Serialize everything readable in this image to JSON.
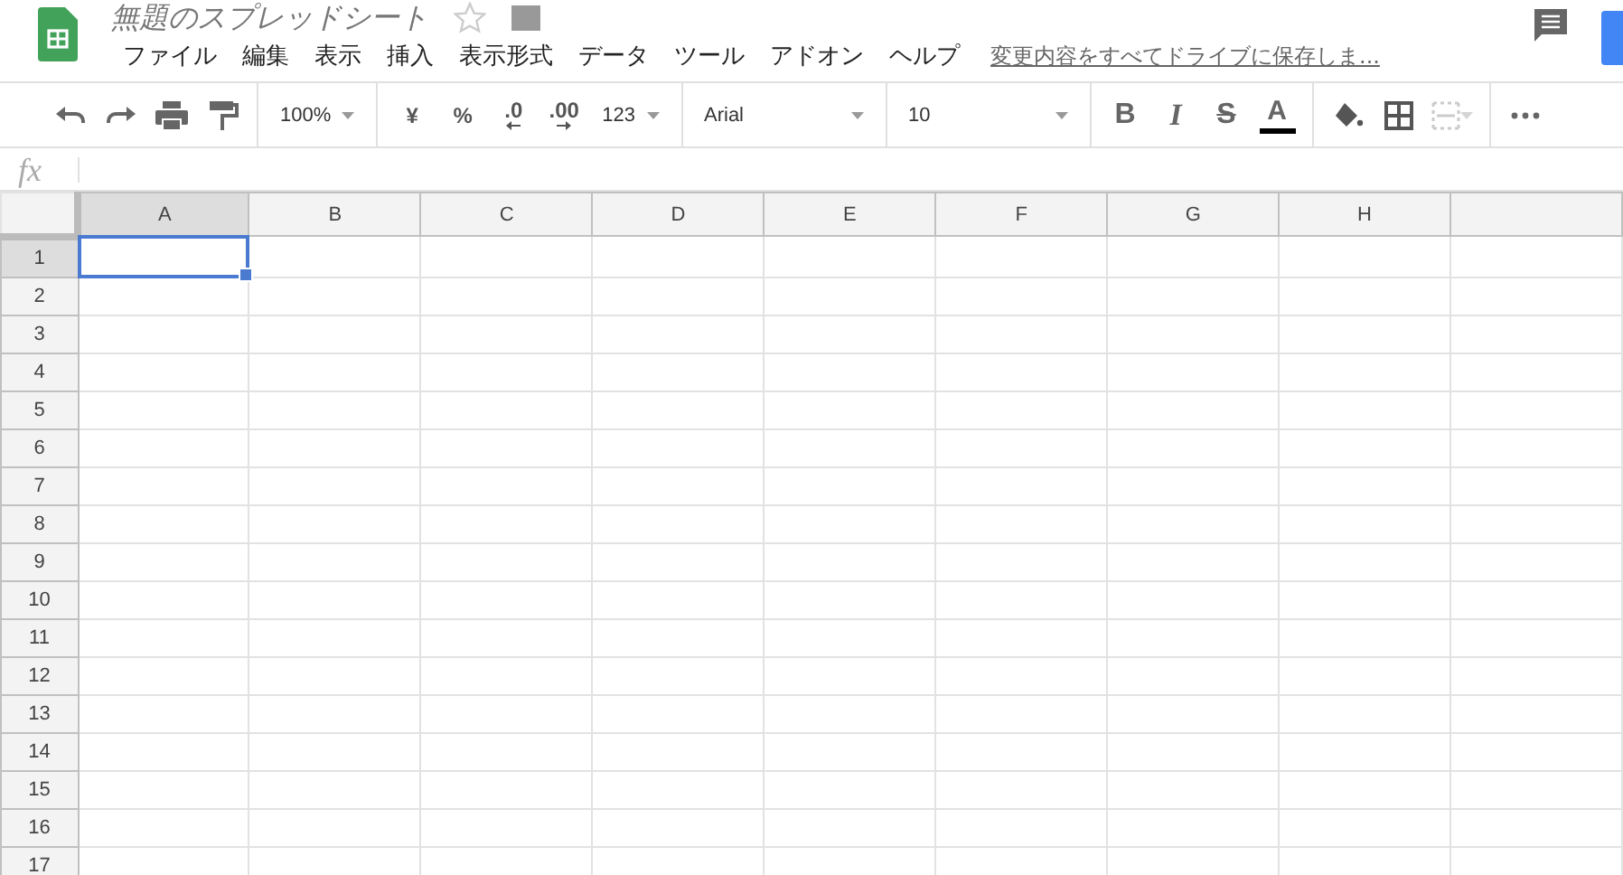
{
  "title": "無題のスプレッドシート",
  "menu": [
    "ファイル",
    "編集",
    "表示",
    "挿入",
    "表示形式",
    "データ",
    "ツール",
    "アドオン",
    "ヘルプ"
  ],
  "save_status": "変更内容をすべてドライブに保存しま...",
  "toolbar": [
    [
      {
        "kind": "undo"
      },
      {
        "kind": "redo"
      },
      {
        "kind": "print"
      },
      {
        "kind": "paint-format"
      }
    ],
    [
      {
        "kind": "dropdown",
        "text": "100%"
      }
    ],
    [
      {
        "kind": "glyph",
        "text": "¥"
      },
      {
        "kind": "glyph",
        "text": "%"
      },
      {
        "kind": "decimal-less",
        "text": ".0"
      },
      {
        "kind": "decimal-more",
        "text": ".00"
      },
      {
        "kind": "dropdown",
        "text": "123"
      }
    ],
    [
      {
        "kind": "select",
        "text": "Arial"
      }
    ],
    [
      {
        "kind": "select",
        "text": "10"
      }
    ],
    [
      {
        "kind": "bold",
        "text": "B"
      },
      {
        "kind": "italic",
        "text": "I"
      },
      {
        "kind": "strike",
        "text": "S"
      },
      {
        "kind": "text-color",
        "text": "A"
      }
    ],
    [
      {
        "kind": "fill"
      },
      {
        "kind": "borders"
      },
      {
        "kind": "merge",
        "disabled": true
      }
    ],
    [
      {
        "kind": "more"
      }
    ]
  ],
  "formula_label": "fx",
  "columns": [
    {
      "label": "A",
      "selected": true
    },
    {
      "label": "B",
      "selected": false
    },
    {
      "label": "C",
      "selected": false
    },
    {
      "label": "D",
      "selected": false
    },
    {
      "label": "E",
      "selected": false
    },
    {
      "label": "F",
      "selected": false
    },
    {
      "label": "G",
      "selected": false
    },
    {
      "label": "H",
      "selected": false
    }
  ],
  "rows": [
    {
      "label": "1",
      "selected": true
    },
    {
      "label": "2",
      "selected": false
    },
    {
      "label": "3",
      "selected": false
    },
    {
      "label": "4",
      "selected": false
    },
    {
      "label": "5",
      "selected": false
    },
    {
      "label": "6",
      "selected": false
    },
    {
      "label": "7",
      "selected": false
    },
    {
      "label": "8",
      "selected": false
    },
    {
      "label": "9",
      "selected": false
    },
    {
      "label": "10",
      "selected": false
    },
    {
      "label": "11",
      "selected": false
    },
    {
      "label": "12",
      "selected": false
    },
    {
      "label": "13",
      "selected": false
    },
    {
      "label": "14",
      "selected": false
    },
    {
      "label": "15",
      "selected": false
    },
    {
      "label": "16",
      "selected": false
    },
    {
      "label": "17",
      "selected": false
    }
  ]
}
